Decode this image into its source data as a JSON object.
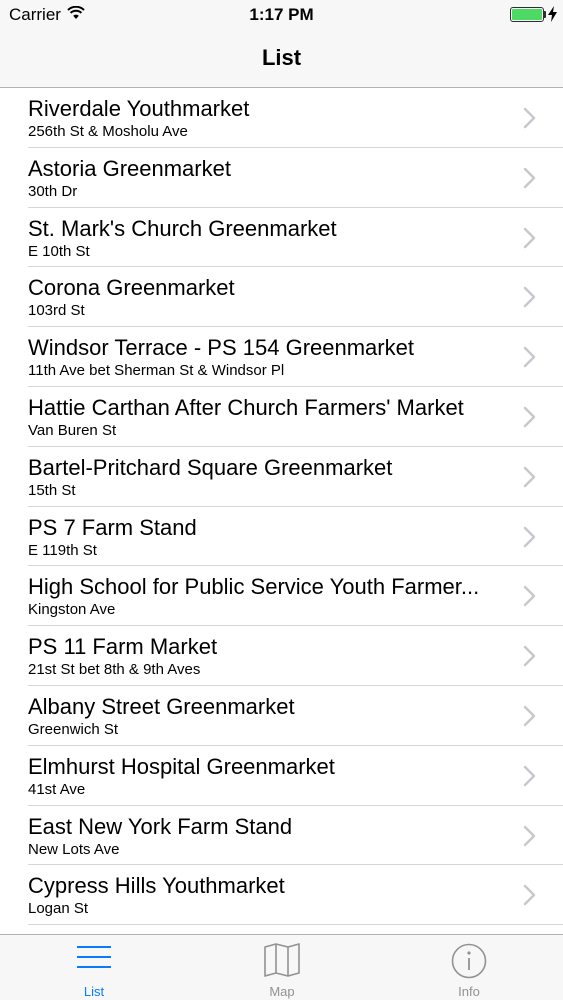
{
  "status_bar": {
    "carrier": "Carrier",
    "time": "1:17 PM",
    "battery_level": 1.0
  },
  "nav": {
    "title": "List"
  },
  "markets": [
    {
      "name": "Riverdale Youthmarket",
      "address": "256th St & Mosholu Ave"
    },
    {
      "name": "Astoria Greenmarket",
      "address": "30th Dr"
    },
    {
      "name": "St. Mark's Church Greenmarket",
      "address": "E 10th St"
    },
    {
      "name": "Corona Greenmarket",
      "address": "103rd St"
    },
    {
      "name": "Windsor Terrace - PS 154 Greenmarket",
      "address": "11th Ave bet Sherman St & Windsor Pl"
    },
    {
      "name": "Hattie Carthan After Church Farmers' Market",
      "address": "Van Buren St"
    },
    {
      "name": "Bartel-Pritchard Square Greenmarket",
      "address": "15th St"
    },
    {
      "name": "PS 7 Farm Stand",
      "address": "E 119th St"
    },
    {
      "name": "High School for Public Service Youth Farmer...",
      "address": "Kingston Ave"
    },
    {
      "name": "PS 11 Farm Market",
      "address": "21st St bet 8th & 9th Aves"
    },
    {
      "name": "Albany Street Greenmarket",
      "address": "Greenwich St"
    },
    {
      "name": "Elmhurst Hospital Greenmarket",
      "address": "41st Ave"
    },
    {
      "name": "East New York Farm Stand",
      "address": "New Lots Ave"
    },
    {
      "name": "Cypress Hills Youthmarket",
      "address": "Logan St"
    }
  ],
  "tabs": [
    {
      "label": "List",
      "icon": "list-icon",
      "active": true
    },
    {
      "label": "Map",
      "icon": "map-icon",
      "active": false
    },
    {
      "label": "Info",
      "icon": "info-icon",
      "active": false
    }
  ],
  "colors": {
    "accent": "#0a7aff",
    "inactive": "#929292",
    "battery": "#4cd964",
    "chevron": "#c7c7cc"
  }
}
